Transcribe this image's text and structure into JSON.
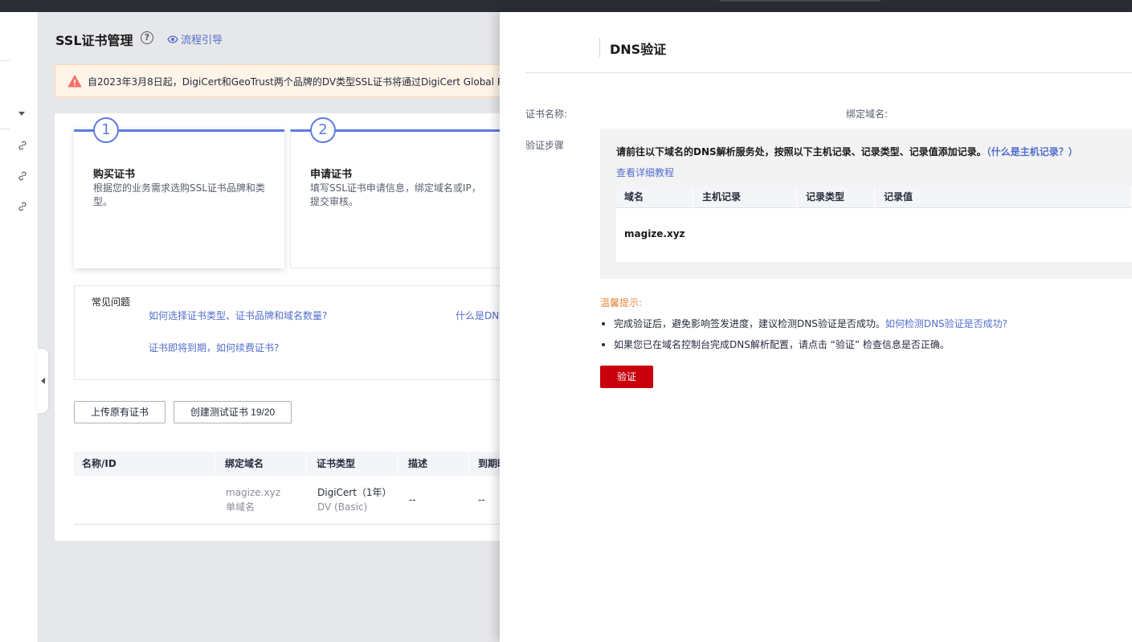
{
  "page": {
    "title": "SSL证书管理",
    "help_icon_glyph": "?",
    "guide_link": "流程引导",
    "notice": "自2023年3月8日起，DigiCert和GeoTrust两个品牌的DV类型SSL证书将通过DigiCert Global Root"
  },
  "steps": [
    {
      "num": "1",
      "title": "购买证书",
      "desc": "根据您的业务需求选购SSL证书品牌和类型。"
    },
    {
      "num": "2",
      "title": "申请证书",
      "desc": "填写SSL证书申请信息，绑定域名或IP，提交审核。"
    }
  ],
  "faq": {
    "title": "常见问题",
    "q1": "如何选择证书类型、证书品牌和域名数量?",
    "q2": "什么是DNS",
    "q3": "证书即将到期，如何续费证书?"
  },
  "actions": {
    "upload": "上传原有证书",
    "create_test": "创建测试证书 19/20"
  },
  "table": {
    "headers": [
      "名称/ID",
      "绑定域名",
      "证书类型",
      "描述",
      "到期时"
    ],
    "row": {
      "domain": "magize.xyz",
      "domain_type": "单域名",
      "cert_type": "DigiCert（1年）",
      "cert_sub": "DV (Basic)",
      "desc": "--",
      "expire": "--"
    }
  },
  "drawer": {
    "title": "DNS验证",
    "cert_name_label": "证书名称:",
    "bound_domain_label": "绑定域名:",
    "steps_label": "验证步骤",
    "instruction": "请前往以下域名的DNS解析服务处，按照以下主机记录、记录类型、记录值添加记录。",
    "instruction_link": "（什么是主机记录？）",
    "tutorial_link": "查看详细教程",
    "dns_table": {
      "headers": [
        "域名",
        "主机记录",
        "记录类型",
        "记录值"
      ],
      "domain": "magize.xyz"
    },
    "tips_title": "温馨提示:",
    "tip1": "完成验证后，避免影响签发进度，建议检测DNS验证是否成功。",
    "tip1_link": "如何检测DNS验证是否成功?",
    "tip2": "如果您已在域名控制台完成DNS解析配置，请点击 “验证” 检查信息是否正确。",
    "verify_button": "验证"
  }
}
